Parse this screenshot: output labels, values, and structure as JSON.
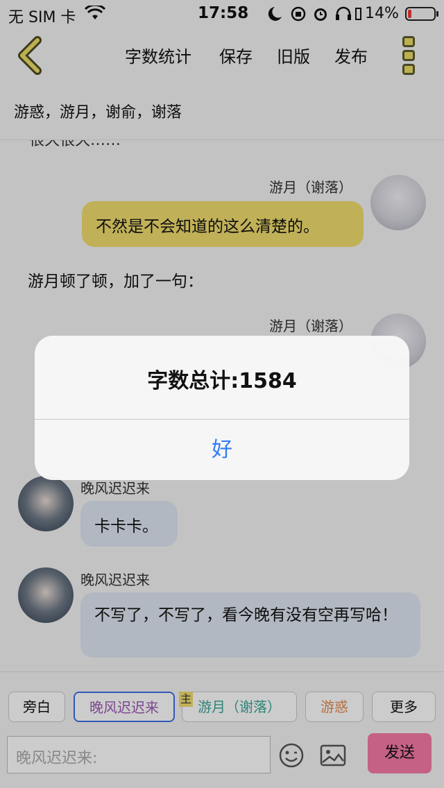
{
  "status_bar": {
    "carrier": "无 SIM 卡",
    "time": "17:58",
    "battery_percent": "14%",
    "battery_level": 0.14,
    "battery_color": "#ee3b3b"
  },
  "nav": {
    "back_icon": "chevron-left-icon",
    "items": [
      "字数统计",
      "保存",
      "旧版",
      "发布"
    ],
    "more_icon": "more-dots-icon",
    "accent": "#ecdc68"
  },
  "participants": "游惑，游月，谢俞，谢落",
  "chat": {
    "cut_text": "很久很久……",
    "messages": [
      {
        "name": "游月（谢落）",
        "text": "不然是不会知道的这么清楚的。",
        "side": "right",
        "bubble_color": "#f1dc6e"
      },
      {
        "narration": "游月顿了顿，加了一句："
      },
      {
        "name": "游月（谢落）",
        "side": "right"
      },
      {
        "name": "晚风迟迟来",
        "text": "卡卡卡。",
        "side": "left",
        "bubble_color": "#dfe6f2"
      },
      {
        "name": "晚风迟迟来",
        "text": "不写了，不写了，看今晚有没有空再写哈！",
        "side": "left",
        "bubble_color": "#dfe6f2"
      }
    ]
  },
  "toolbar": {
    "roles": [
      {
        "label": "旁白",
        "color": "#111111"
      },
      {
        "label": "晚风迟迟来",
        "color": "#9b59b6",
        "selected": true,
        "border": "#3d6ee5"
      },
      {
        "label": "游月（谢落）",
        "color": "#3aa79a",
        "host_badge": "主"
      },
      {
        "label": "游惑",
        "color": "#e08a52"
      },
      {
        "label": "更多",
        "color": "#111111"
      }
    ],
    "input_placeholder": "晚风迟迟来:",
    "emoji_icon": "emoji-icon",
    "image_icon": "image-icon",
    "send_label": "发送",
    "send_color": "#f57aa6"
  },
  "alert": {
    "title": "字数总计:1584",
    "button": "好",
    "button_color": "#2e7cf6"
  }
}
